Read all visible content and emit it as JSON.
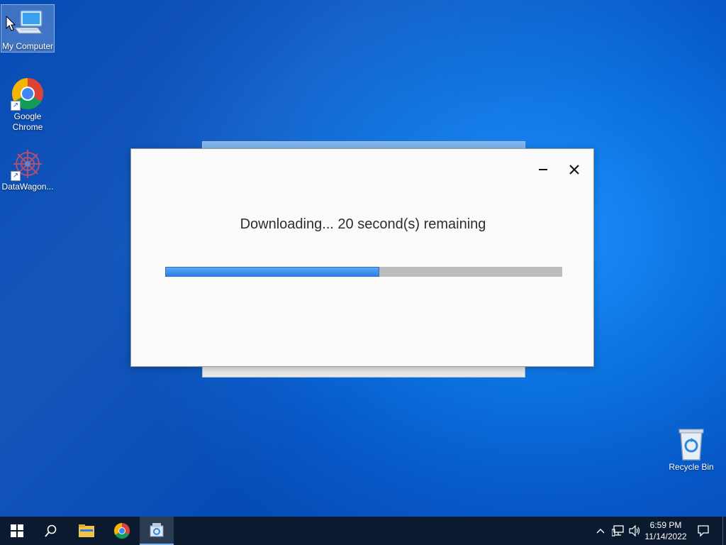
{
  "desktop": {
    "icons": [
      {
        "label": "My Computer"
      },
      {
        "label": "Google Chrome"
      },
      {
        "label": "DataWagon..."
      },
      {
        "label": "Recycle Bin"
      }
    ]
  },
  "dialog": {
    "message": "Downloading... 20 second(s) remaining",
    "progress": 0.54,
    "accent_color": "#2f80e6",
    "track_color": "#bcbcbc"
  },
  "taskbar": {
    "time": "6:59 PM",
    "date": "11/14/2022",
    "items": [
      "start-icon",
      "search-icon",
      "file-explorer-icon",
      "chrome-icon",
      "app-icon"
    ],
    "tray": [
      "chevron-up-icon",
      "network-icon",
      "volume-icon",
      "notification-icon"
    ]
  }
}
